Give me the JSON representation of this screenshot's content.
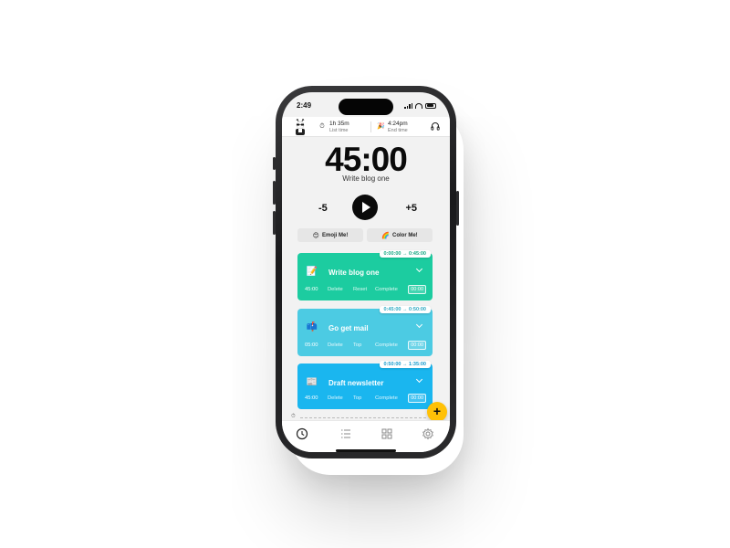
{
  "status_bar": {
    "time": "2:49"
  },
  "header": {
    "list_time_value": "1h 35m",
    "list_time_label": "List time",
    "end_time_value": "4:24pm",
    "end_time_label": "End time"
  },
  "timer": {
    "display": "45:00",
    "task_title": "Write blog one",
    "minus_label": "-5",
    "plus_label": "+5"
  },
  "actions": {
    "emoji_label": "Emoji Me!",
    "emoji_icon": "😊",
    "color_label": "Color Me!",
    "color_icon": "🌈"
  },
  "tasks": [
    {
      "name": "Write blog one",
      "emoji": "📝",
      "range": "0:00:00 → 0:45:00",
      "duration": "45:00",
      "actions": [
        "Delete",
        "Reset",
        "Complete"
      ],
      "elapsed": "00:00",
      "color": "#1ccca0"
    },
    {
      "name": "Go get mail",
      "emoji": "📫",
      "range": "0:45:00 → 0:50:00",
      "duration": "05:00",
      "actions": [
        "Delete",
        "Top",
        "Complete"
      ],
      "elapsed": "00:00",
      "color": "#4ccbe3"
    },
    {
      "name": "Draft newsletter",
      "emoji": "📰",
      "range": "0:50:00 → 1:35:00",
      "duration": "45:00",
      "actions": [
        "Delete",
        "Top",
        "Complete"
      ],
      "elapsed": "00:00",
      "color": "#1ab6ef"
    }
  ],
  "fab": {
    "label": "+"
  },
  "tab_bar": {
    "items": [
      "clock-icon",
      "list-icon",
      "grid-icon",
      "settings-icon"
    ]
  }
}
